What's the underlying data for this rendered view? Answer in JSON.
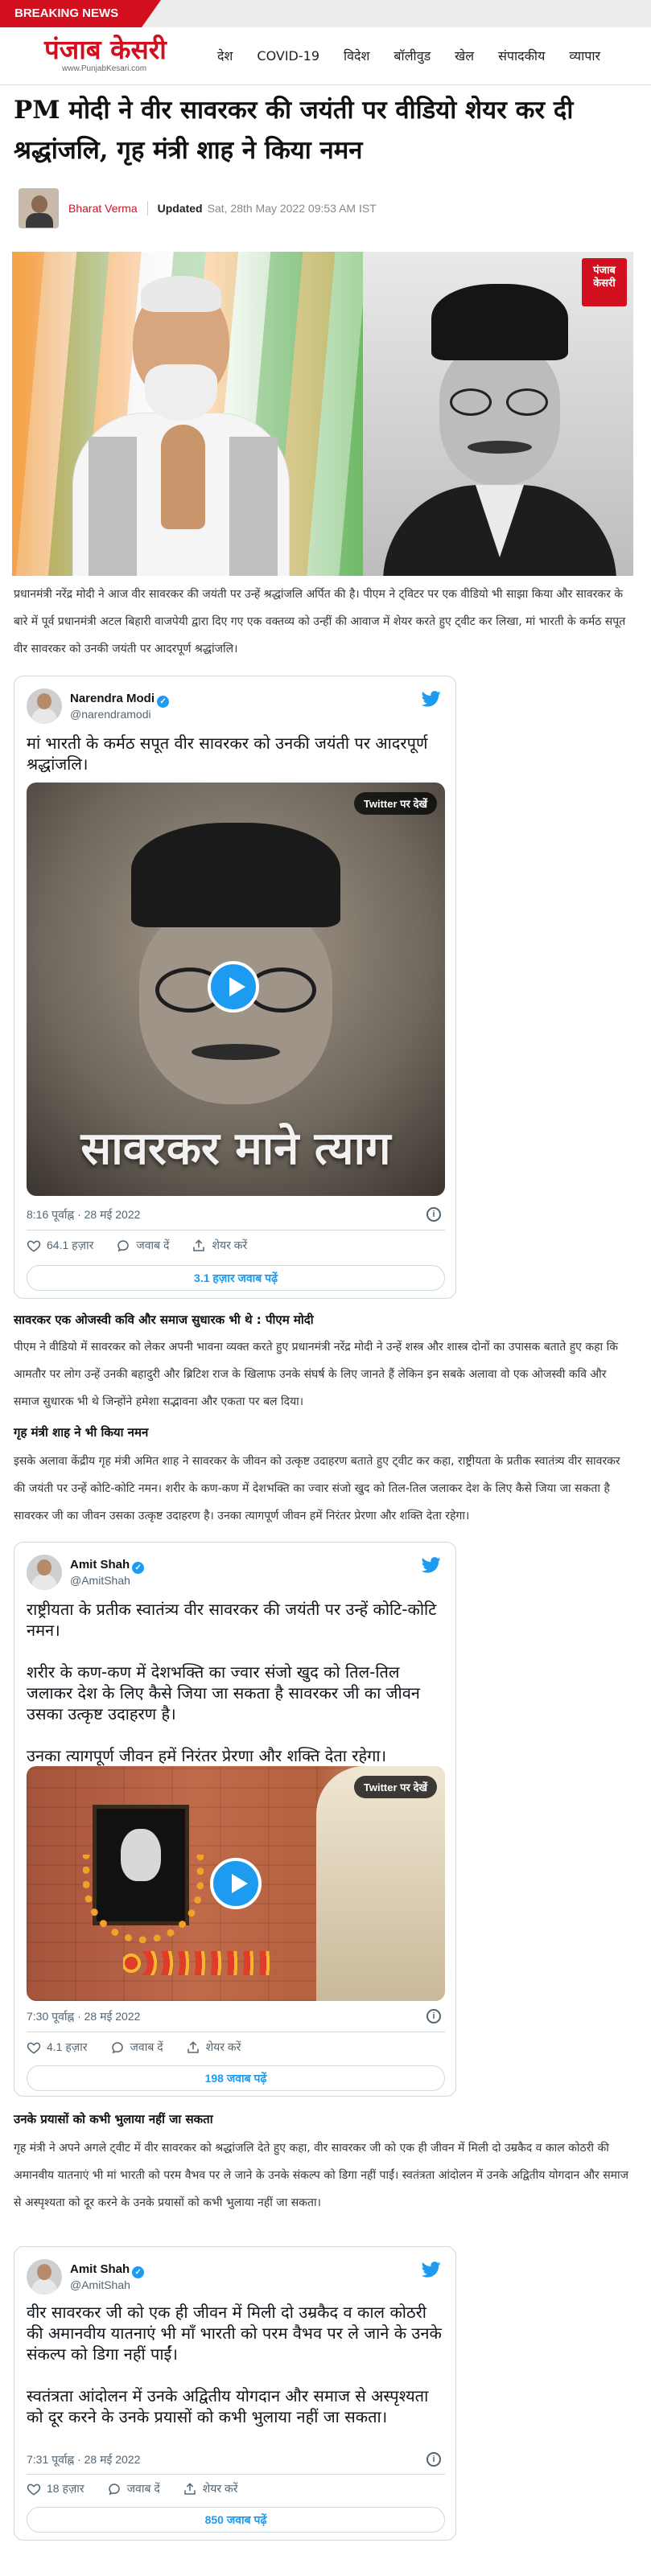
{
  "breaking": {
    "label": "BREAKING NEWS"
  },
  "header": {
    "logo": {
      "brand": "पंजाब केसरी",
      "site": "www.PunjabKesari.com"
    },
    "nav": [
      "देश",
      "COVID-19",
      "विदेश",
      "बॉलीवुड",
      "खेल",
      "संपादकीय",
      "व्यापार"
    ]
  },
  "article": {
    "title": "PM मोदी ने वीर सावरकर की जयंती पर वीडियो शेयर कर दी श्रद्धांजलि, गृह मंत्री शाह ने किया नमन",
    "author": "Bharat Verma",
    "updated_label": "Updated",
    "updated_date": "Sat, 28th May 2022 09:53 AM IST",
    "hero_watermark": "पंजाब केसरी",
    "para1": "प्रधानमंत्री नरेंद्र मोदी ने आज वीर सावरकर की जयंती पर उन्हें श्रद्धांजलि अर्पित की है। पीएम ने ट्विटर पर एक वीडियो भी साझा किया और सावरकर के बारे में पूर्व प्रधानमंत्री अटल बिहारी वाजपेयी द्वारा दिए गए एक वक्तव्य को उन्हीं की आवाज में शेयर करते हुए ट्वीट कर लिखा, मां भारती के कर्मठ सपूत वीर सावरकर को उनकी जयंती पर आदरपूर्ण श्रद्धांजलि।",
    "subhead1": "सावरकर एक ओजस्वी कवि और समाज सुधारक भी थे : पीएम मोदी",
    "para2": "पीएम ने वीडियो में सावरकर को लेकर अपनी भावना व्यक्त करते हुए प्रधानमंत्री नरेंद्र मोदी ने उन्हें शस्त्र और शास्त्र दोनों का उपासक बताते हुए कहा कि आमतौर पर लोग उन्हें उनकी बहादुरी और ब्रिटिश राज के खिलाफ उनके संघर्ष के लिए जानते हैं लेकिन इन सबके अलावा वो एक ओजस्वी कवि और समाज सुधारक भी थे जिन्होंने हमेशा सद्भावना और एकता पर बल दिया।",
    "subhead2": "गृह मंत्री शाह ने भी किया नमन",
    "para3": "इसके अलावा केंद्रीय गृह मंत्री अमित शाह ने सावरकर के जीवन को उत्कृष्ट उदाहरण बताते हुए ट्वीट कर कहा, राष्ट्रीयता के प्रतीक स्वातंत्र्य वीर सावरकर की जयंती पर उन्हें कोटि-कोटि नमन। शरीर के कण-कण में देशभक्ति का ज्वार संजो खुद को तिल-तिल जलाकर देश के लिए कैसे जिया जा सकता है सावरकर जी का जीवन उसका उत्कृष्ट उदाहरण है। उनका त्यागपूर्ण जीवन हमें निरंतर प्रेरणा और शक्ति देता रहेगा।",
    "subhead3": "उनके प्रयासों को कभी भुलाया नहीं जा सकता",
    "para4": "गृह मंत्री ने अपने अगले ट्वीट में वीर सावरकर को श्रद्धांजलि देते हुए कहा, वीर सावरकर जी को एक ही जीवन में मिली दो उम्रकैद व काल कोठरी की अमानवीय यातनाएं भी मां भारती को परम वैभव पर ले जाने के उनके संकल्प को डिगा नहीं पाईं। स्वतंत्रता आंदोलन में उनके अद्वितीय योगदान और समाज से अस्पृश्यता को दूर करने के उनके प्रयासों को कभी भुलाया नहीं जा सकता।"
  },
  "tweets": [
    {
      "name": "Narendra Modi",
      "handle": "@narendramodi",
      "text": "मां भारती के कर्मठ सपूत वीर सावरकर को उनकी जयंती पर आदरपूर्ण श्रद्धांजलि।",
      "media_pill": "Twitter पर देखें",
      "video_caption": "सावरकर माने त्याग",
      "time": "8:16 पूर्वाह्न · 28 मई 2022",
      "likes": "64.1 हज़ार",
      "reply": "जवाब दें",
      "share": "शेयर करें",
      "replies_button": "3.1 हज़ार जवाब पढ़ें"
    },
    {
      "name": "Amit Shah",
      "handle": "@AmitShah",
      "text": "राष्ट्रीयता के प्रतीक स्वातंत्र्य वीर सावरकर की जयंती पर उन्हें कोटि-कोटि नमन।\n\nशरीर के कण-कण में देशभक्ति का ज्वार संजो खुद को तिल-तिल जलाकर देश के लिए कैसे जिया जा सकता है सावरकर जी का जीवन उसका उत्कृष्ट उदाहरण है।\n\nउनका त्यागपूर्ण जीवन हमें निरंतर प्रेरणा और शक्ति देता रहेगा।",
      "media_pill": "Twitter पर देखें",
      "time": "7:30 पूर्वाह्न · 28 मई 2022",
      "likes": "4.1 हज़ार",
      "reply": "जवाब दें",
      "share": "शेयर करें",
      "replies_button": "198 जवाब पढ़ें"
    },
    {
      "name": "Amit Shah",
      "handle": "@AmitShah",
      "text": "वीर सावरकर जी को एक ही जीवन में मिली दो उम्रकैद व काल कोठरी की अमानवीय यातनाएं भी माँ भारती को परम वैभव पर ले जाने के उनके संकल्प को डिगा नहीं पाईं।\n\nस्वतंत्रता आंदोलन में उनके अद्वितीय योगदान और समाज से अस्पृश्यता को दूर करने के उनके प्रयासों को कभी भुलाया नहीं जा सकता।",
      "time": "7:31 पूर्वाह्न · 28 मई 2022",
      "likes": "18 हज़ार",
      "reply": "जवाब दें",
      "share": "शेयर करें",
      "replies_button": "850 जवाब पढ़ें"
    }
  ],
  "colors": {
    "brand_red": "#d10f1e",
    "twitter_blue": "#1d9bf0"
  }
}
